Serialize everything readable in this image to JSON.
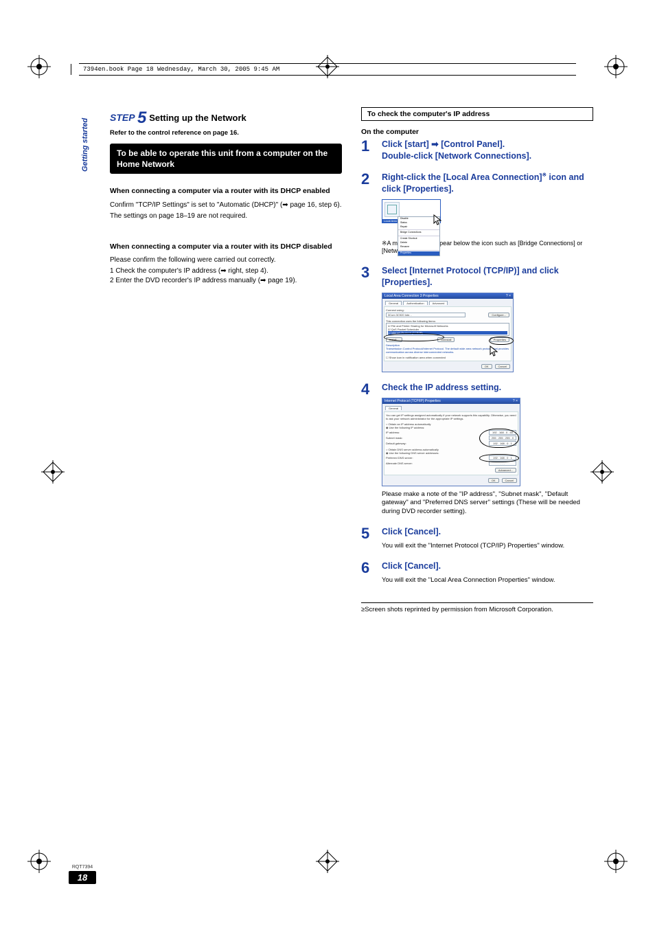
{
  "meta": {
    "bookline": "7394en.book  Page 18  Wednesday, March 30, 2005  9:45 AM",
    "sidebar_label": "Getting started",
    "rqt": "RQT7394",
    "page_number": "18"
  },
  "left": {
    "step_label": "STEP",
    "step_num": "5",
    "step_tail": "Setting up the Network",
    "refer": "Refer to the control reference on page 16.",
    "blackbar": "To be able to operate this unit from a computer on the Home Network",
    "sub1": "When connecting a computer via a router with its DHCP enabled",
    "sub1_body1": "Confirm \"TCP/IP Settings\" is set to \"Automatic (DHCP)\" (➡ page 16, step 6).",
    "sub1_body2": "The settings on page 18–19 are not required.",
    "sub2": "When connecting a computer via a router with its DHCP disabled",
    "sub2_intro": "Please confirm the following were carried out correctly.",
    "sub2_li1": "1  Check the computer's IP address (➡ right, step 4).",
    "sub2_li2": "2  Enter the DVD recorder's IP address manually (➡ page 19)."
  },
  "right": {
    "boxed": "To check the computer's IP address",
    "on_the": "On the computer",
    "s1a": "Click [start] ➡ [Control Panel].",
    "s1b": "Double-click [Network Connections].",
    "s2": "Right-click the [Local Area Connection]※ icon and click [Properties].",
    "s2_note": "※A message may appear below the icon such as [Bridge Connections] or [Network Bridge].",
    "s3": "Select [Internet Protocol (TCP/IP)] and click [Properties].",
    "s4": "Check the IP address setting.",
    "s4_note": "Please make a note of the \"IP address\", \"Subnet mask\", \"Default gateway\" and \"Preferred DNS server\" settings (These will be needed during DVD recorder setting).",
    "s5": "Click [Cancel].",
    "s5_note": "You will exit the \"Internet Protocol (TCP/IP) Properties\" window.",
    "s6": "Click [Cancel].",
    "s6_note": "You will exit the \"Local Area Connection Properties\" window.",
    "footnote": "≥Screen shots reprinted by permission from Microsoft Corporation."
  },
  "shots": {
    "menu": {
      "label": "Local Area Connection",
      "items": [
        "Disable",
        "Status",
        "Repair",
        "—",
        "Bridge Connections",
        "—",
        "Create Shortcut",
        "Delete",
        "Rename",
        "—",
        "Properties"
      ]
    },
    "lacp": {
      "title": "Local Area Connection 3 Properties",
      "tabs": [
        "General",
        "Authentication",
        "Advanced"
      ],
      "connect_using": "Connect using:",
      "adapter": "3Com 3C920 Inte...",
      "configure": "Configure...",
      "uses": "This connection uses the following items:",
      "items": [
        "File and Printer Sharing for Microsoft Networks",
        "QoS Packet Scheduler",
        "Internet Protocol (TCP/IP)"
      ],
      "install": "Install...",
      "uninstall": "Uninstall",
      "properties": "Properties",
      "desc_h": "Description",
      "desc": "Transmission Control Protocol/Internet Protocol. The default wide area network protocol that provides communication across diverse interconnected networks.",
      "notify": "Show icon in notification area when connected",
      "ok": "OK",
      "cancel": "Cancel"
    },
    "tcpip": {
      "title": "Internet Protocol (TCP/IP) Properties",
      "tab": "General",
      "blurb": "You can get IP settings assigned automatically if your network supports this capability. Otherwise, you need to ask your network administrator for the appropriate IP settings.",
      "r1": "Obtain an IP address automatically",
      "r2": "Use the following IP address:",
      "ip_l": "IP address:",
      "ip_v": "192 . 168 .   0 .  50",
      "sm_l": "Subnet mask:",
      "sm_v": "255 . 255 . 255 .   0",
      "gw_l": "Default gateway:",
      "gw_v": "192 . 168 .   0 .   1",
      "r3": "Obtain DNS server address automatically",
      "r4": "Use the following DNS server addresses:",
      "dns1_l": "Preferred DNS server:",
      "dns1_v": "192 . 168 .   0 .   1",
      "dns2_l": "Alternate DNS server:",
      "dns2_v": " .     .     .    ",
      "advanced": "Advanced...",
      "ok": "OK",
      "cancel": "Cancel"
    }
  }
}
